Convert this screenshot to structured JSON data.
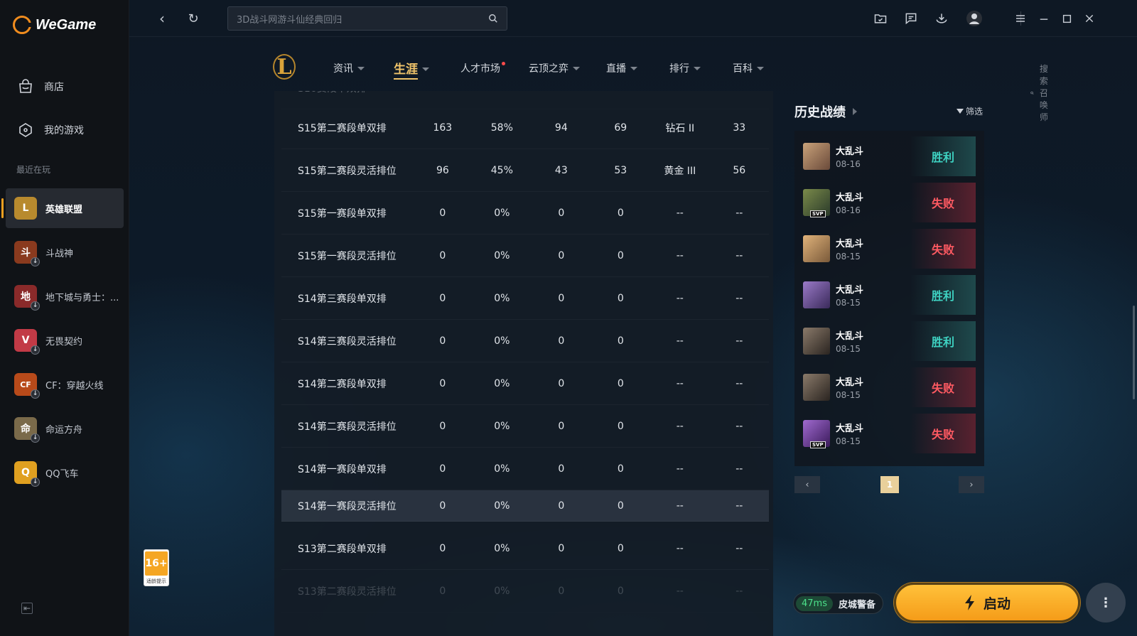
{
  "app": {
    "name": "WeGame"
  },
  "sidebar": {
    "nav": [
      {
        "label": "商店",
        "icon": "store-icon"
      },
      {
        "label": "我的游戏",
        "icon": "my-games-icon"
      }
    ],
    "recent_label": "最近在玩",
    "games": [
      {
        "label": "英雄联盟",
        "icon": "league-of-legends-icon",
        "active": true,
        "color": "#b88a2e",
        "glyph": "L"
      },
      {
        "label": "斗战神",
        "icon": "douzhanshen-icon",
        "color": "#8a3a1e",
        "glyph": "斗"
      },
      {
        "label": "地下城与勇士：...",
        "icon": "dnf-icon",
        "color": "#8a2a2a",
        "glyph": "地"
      },
      {
        "label": "无畏契约",
        "icon": "valorant-icon",
        "color": "#c23a46",
        "glyph": "V"
      },
      {
        "label": "CF：穿越火线",
        "icon": "crossfire-icon",
        "color": "#b84a1a",
        "glyph": "CF"
      },
      {
        "label": "命运方舟",
        "icon": "lost-ark-icon",
        "color": "#7a6a4a",
        "glyph": "命"
      },
      {
        "label": "QQ飞车",
        "icon": "qq-speed-icon",
        "color": "#e0a020",
        "glyph": "Q"
      }
    ]
  },
  "topbar": {
    "search_placeholder": "3D战斗网游斗仙经典回归"
  },
  "game_nav": {
    "items": [
      {
        "label": "资讯",
        "caret": true
      },
      {
        "label": "生涯",
        "caret": true,
        "active": true
      },
      {
        "label": "人才市场",
        "dot": true
      },
      {
        "label": "云顶之弈",
        "caret": true
      },
      {
        "label": "直播",
        "caret": true
      },
      {
        "label": "排行",
        "caret": true
      },
      {
        "label": "百科",
        "caret": true
      }
    ],
    "summoner_search_placeholder": "搜索召唤师"
  },
  "season_table": {
    "rows": [
      {
        "season": "S15第二赛段单双排",
        "games": "163",
        "winrate": "58%",
        "wins": "94",
        "losses": "69",
        "rank": "钻石 II",
        "lp": "33"
      },
      {
        "season": "S15第二赛段灵活排位",
        "games": "96",
        "winrate": "45%",
        "wins": "43",
        "losses": "53",
        "rank": "黄金 III",
        "lp": "56"
      },
      {
        "season": "S15第一赛段单双排",
        "games": "0",
        "winrate": "0%",
        "wins": "0",
        "losses": "0",
        "rank": "--",
        "lp": "--"
      },
      {
        "season": "S15第一赛段灵活排位",
        "games": "0",
        "winrate": "0%",
        "wins": "0",
        "losses": "0",
        "rank": "--",
        "lp": "--"
      },
      {
        "season": "S14第三赛段单双排",
        "games": "0",
        "winrate": "0%",
        "wins": "0",
        "losses": "0",
        "rank": "--",
        "lp": "--"
      },
      {
        "season": "S14第三赛段灵活排位",
        "games": "0",
        "winrate": "0%",
        "wins": "0",
        "losses": "0",
        "rank": "--",
        "lp": "--"
      },
      {
        "season": "S14第二赛段单双排",
        "games": "0",
        "winrate": "0%",
        "wins": "0",
        "losses": "0",
        "rank": "--",
        "lp": "--"
      },
      {
        "season": "S14第二赛段灵活排位",
        "games": "0",
        "winrate": "0%",
        "wins": "0",
        "losses": "0",
        "rank": "--",
        "lp": "--"
      },
      {
        "season": "S14第一赛段单双排",
        "games": "0",
        "winrate": "0%",
        "wins": "0",
        "losses": "0",
        "rank": "--",
        "lp": "--"
      },
      {
        "season": "S14第一赛段灵活排位",
        "games": "0",
        "winrate": "0%",
        "wins": "0",
        "losses": "0",
        "rank": "--",
        "lp": "--"
      },
      {
        "season": "S13第二赛段单双排",
        "games": "0",
        "winrate": "0%",
        "wins": "0",
        "losses": "0",
        "rank": "--",
        "lp": "--"
      },
      {
        "season": "S13第二赛段灵活排位",
        "games": "0",
        "winrate": "0%",
        "wins": "0",
        "losses": "0",
        "rank": "--",
        "lp": "--"
      }
    ]
  },
  "history": {
    "title": "历史战绩",
    "filter_label": "筛选",
    "matches": [
      {
        "mode": "大乱斗",
        "date": "08-16",
        "result": "胜利",
        "win": true,
        "svp": false,
        "color": "#8c6a4a"
      },
      {
        "mode": "大乱斗",
        "date": "08-16",
        "result": "失败",
        "win": false,
        "svp": true,
        "svp_label": "SVP",
        "color": "#5a6a3a"
      },
      {
        "mode": "大乱斗",
        "date": "08-15",
        "result": "失败",
        "win": false,
        "svp": false,
        "color": "#b08a5a"
      },
      {
        "mode": "大乱斗",
        "date": "08-15",
        "result": "胜利",
        "win": true,
        "svp": false,
        "color": "#6a4a8a"
      },
      {
        "mode": "大乱斗",
        "date": "08-15",
        "result": "胜利",
        "win": true,
        "svp": false,
        "color": "#5a4a3a"
      },
      {
        "mode": "大乱斗",
        "date": "08-15",
        "result": "失败",
        "win": false,
        "svp": false,
        "color": "#5a4a3a"
      },
      {
        "mode": "大乱斗",
        "date": "08-15",
        "result": "失败",
        "win": false,
        "svp": true,
        "svp_label": "SVP",
        "color": "#6a3a8a"
      }
    ],
    "current_page": "1"
  },
  "age_rating": {
    "age": "16+",
    "label": "适龄提示"
  },
  "bottom": {
    "ping": "47ms",
    "server": "皮城警备",
    "launch_label": "启动"
  }
}
